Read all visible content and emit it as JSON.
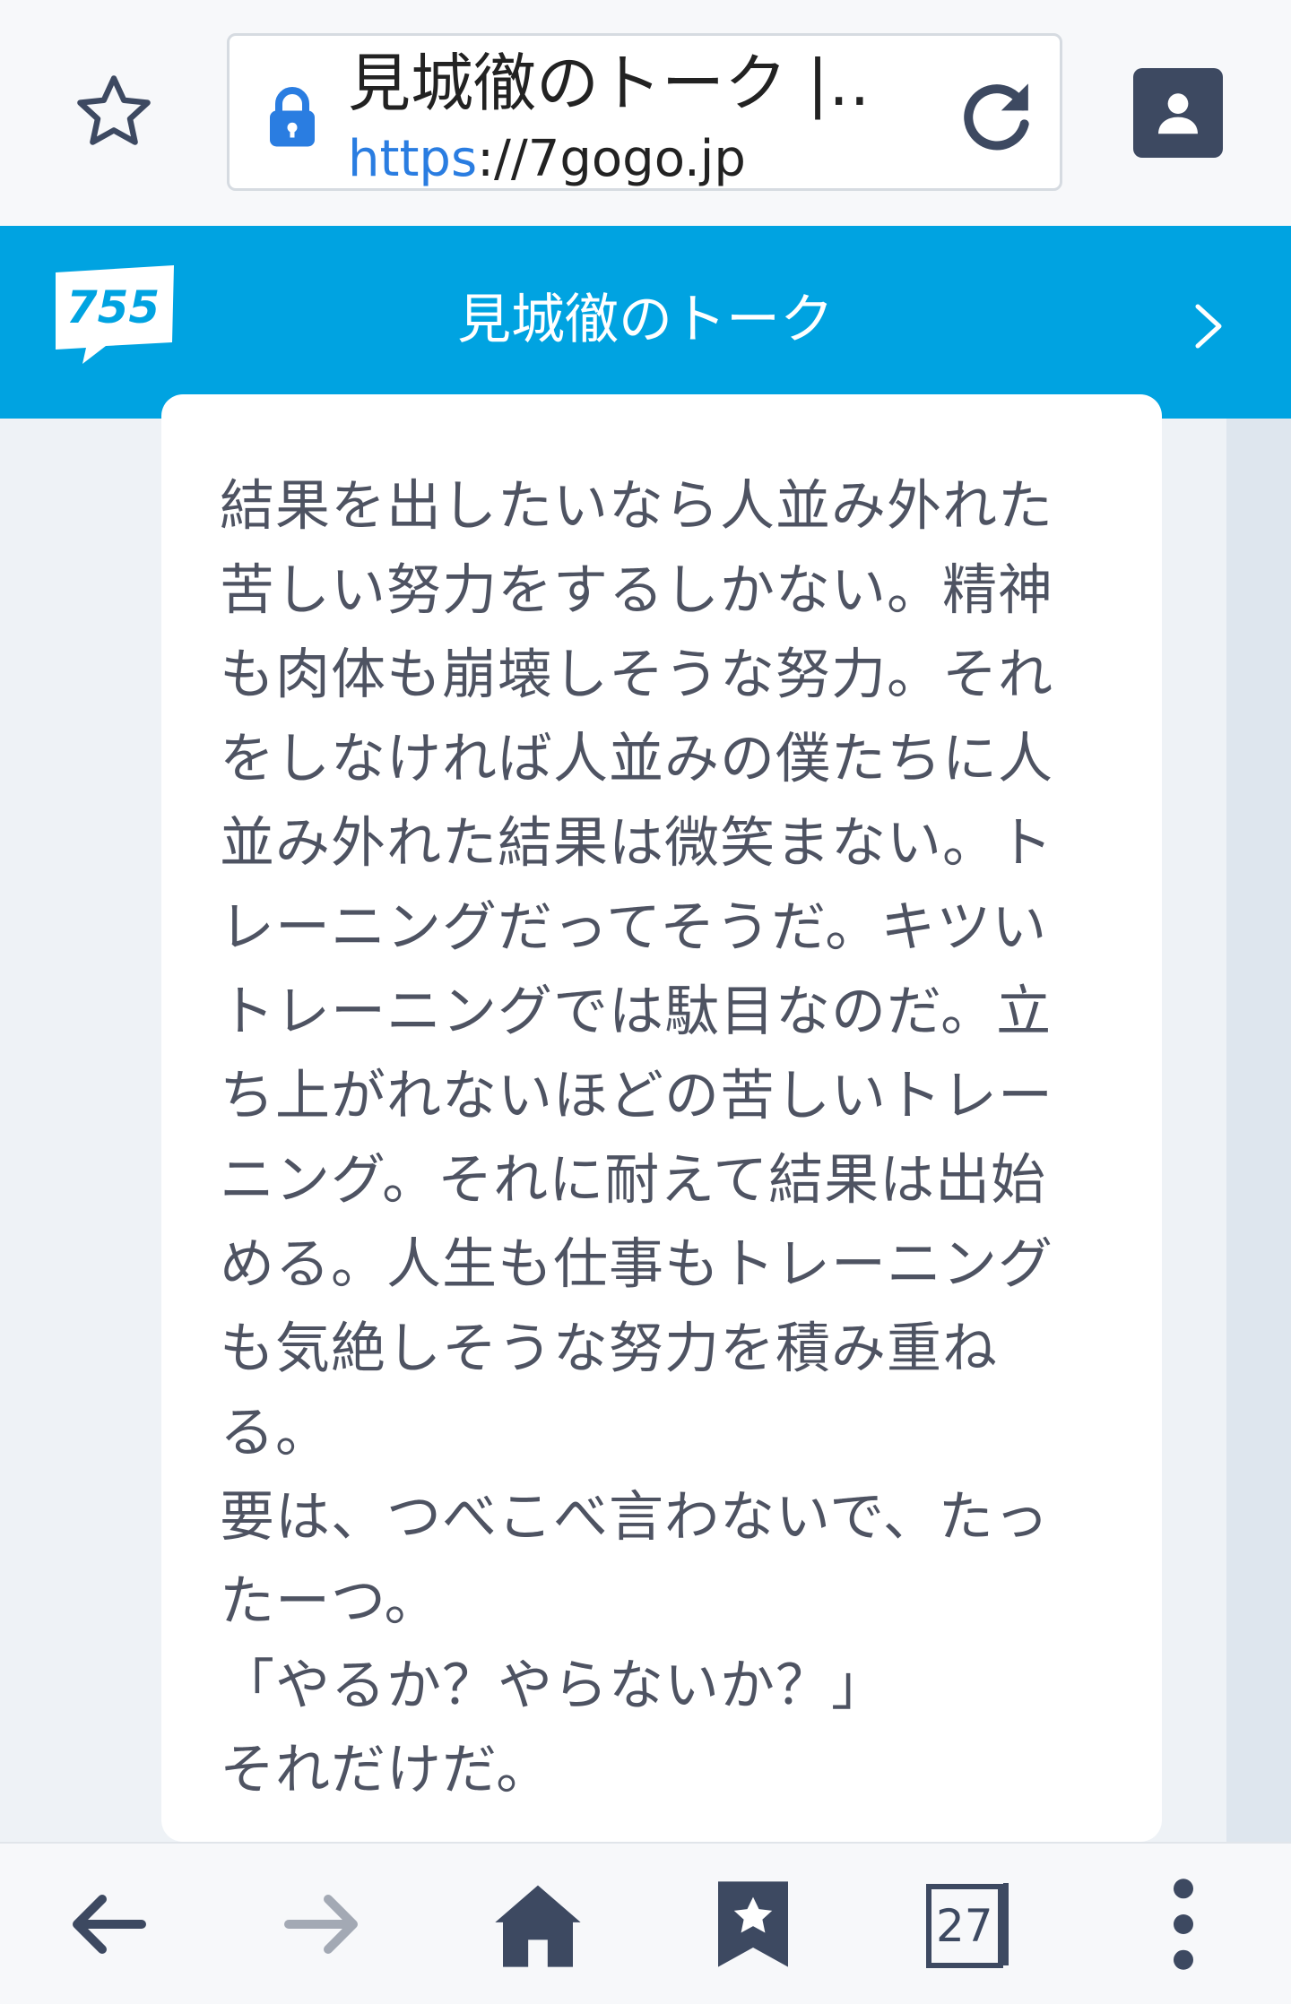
{
  "browser": {
    "tab_title": "見城徹のトーク |…",
    "url_scheme": "https",
    "url_rest": "://7gogo.jp",
    "colors": {
      "scheme": "#2a7de1",
      "lock": "#2a7de1",
      "icon": "#3d4961"
    }
  },
  "site": {
    "logo_text": "755",
    "header_title": "見城徹のトーク",
    "brand_color": "#00a3e1"
  },
  "post": {
    "text": "結果を出したいなら人並み外れた苦しい努力をするしかない。精神も肉体も崩壊しそうな努力。それをしなければ人並みの僕たちに人並み外れた結果は微笑まない。トレーニングだってそうだ。キツいトレーニングでは駄目なのだ。立ち上がれないほどの苦しいトレーニング。それに耐えて結果は出始める。人生も仕事もトレーニングも気絶しそうな努力を積み重ねる。\n要は、つべこべ言わないで、たったーつ。\n「やるか？やらないか？」\nそれだけだ。"
  },
  "bottom_nav": {
    "tab_count": "27",
    "icons": [
      "back-arrow-icon",
      "forward-arrow-icon",
      "home-icon",
      "bookmarks-icon",
      "tabs-icon",
      "more-vertical-icon"
    ]
  }
}
